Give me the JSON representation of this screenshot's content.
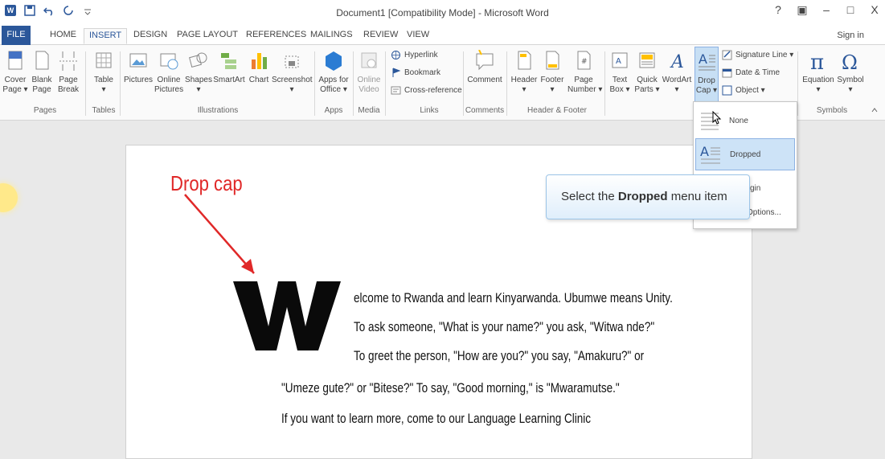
{
  "window": {
    "title": "Document1 [Compatibility Mode] - Microsoft Word",
    "controls": [
      "?",
      "▣",
      "–",
      "□",
      "X"
    ]
  },
  "tabs": [
    {
      "label": "FILE"
    },
    {
      "label": "HOME"
    },
    {
      "label": "INSERT"
    },
    {
      "label": "DESIGN"
    },
    {
      "label": "PAGE LAYOUT"
    },
    {
      "label": "REFERENCES"
    },
    {
      "label": "MAILINGS"
    },
    {
      "label": "REVIEW"
    },
    {
      "label": "VIEW"
    }
  ],
  "signin": "Sign in",
  "ribbon": {
    "pages": {
      "group": "Pages",
      "cover": [
        "Cover",
        "Page ▾"
      ],
      "blank": [
        "Blank",
        "Page"
      ],
      "break": [
        "Page",
        "Break"
      ]
    },
    "tables": {
      "group": "Tables",
      "table": [
        "Table",
        "▾"
      ]
    },
    "illustrations": {
      "group": "Illustrations",
      "pictures": [
        "Pictures",
        ""
      ],
      "online_pictures": [
        "Online",
        "Pictures"
      ],
      "shapes": [
        "Shapes",
        "▾"
      ],
      "smartart": [
        "SmartArt",
        ""
      ],
      "chart": [
        "Chart",
        ""
      ],
      "screenshot": [
        "Screenshot",
        "▾"
      ]
    },
    "apps": {
      "group": "Apps",
      "office": [
        "Apps for",
        "Office ▾"
      ]
    },
    "media": {
      "group": "Media",
      "video": [
        "Online",
        "Video"
      ]
    },
    "links": {
      "group": "Links",
      "hyperlink": "Hyperlink",
      "bookmark": "Bookmark",
      "crossref": "Cross-reference"
    },
    "comments": {
      "group": "Comments",
      "comment": [
        "Comment",
        ""
      ]
    },
    "header_footer": {
      "group": "Header & Footer",
      "header": [
        "Header",
        "▾"
      ],
      "footer": [
        "Footer",
        "▾"
      ],
      "page_number": [
        "Page",
        "Number ▾"
      ]
    },
    "text": {
      "textbox": [
        "Text",
        "Box ▾"
      ],
      "quickparts": [
        "Quick",
        "Parts ▾"
      ],
      "wordart": [
        "WordArt",
        "▾"
      ],
      "dropcap": [
        "Drop",
        "Cap ▾"
      ],
      "signature": "Signature Line ▾",
      "datetime": "Date & Time",
      "object": "Object ▾"
    },
    "symbols": {
      "group": "Symbols",
      "equation": [
        "Equation",
        "▾"
      ],
      "symbol": [
        "Symbol",
        "▾"
      ]
    }
  },
  "dropcap_menu": {
    "items": [
      {
        "label": "None"
      },
      {
        "label": "Dropped"
      },
      {
        "label": "gin"
      },
      {
        "label": "Options..."
      }
    ]
  },
  "callout": {
    "prefix": "Select the ",
    "bold": "Dropped",
    "suffix": " menu item"
  },
  "annotation": "Drop cap",
  "document": {
    "dropcap_letter": "W",
    "lines": [
      "elcome to Rwanda and learn Kinyarwanda. Ubumwe means Unity.",
      "To ask someone, \"What is your name?\" you ask, \"Witwa nde?\"",
      "To greet the person, \"How are you?\" you say, \"Amakuru?\" or",
      "\"Umeze gute?\" or \"Bitese?\" To say, \"Good morning,\" is \"Mwaramutse.\"",
      "If you want to learn more, come to our Language Learning Clinic"
    ]
  },
  "colors": {
    "accent": "#2b579a",
    "annotation": "#e02828",
    "highlight": "#cde3f7"
  }
}
